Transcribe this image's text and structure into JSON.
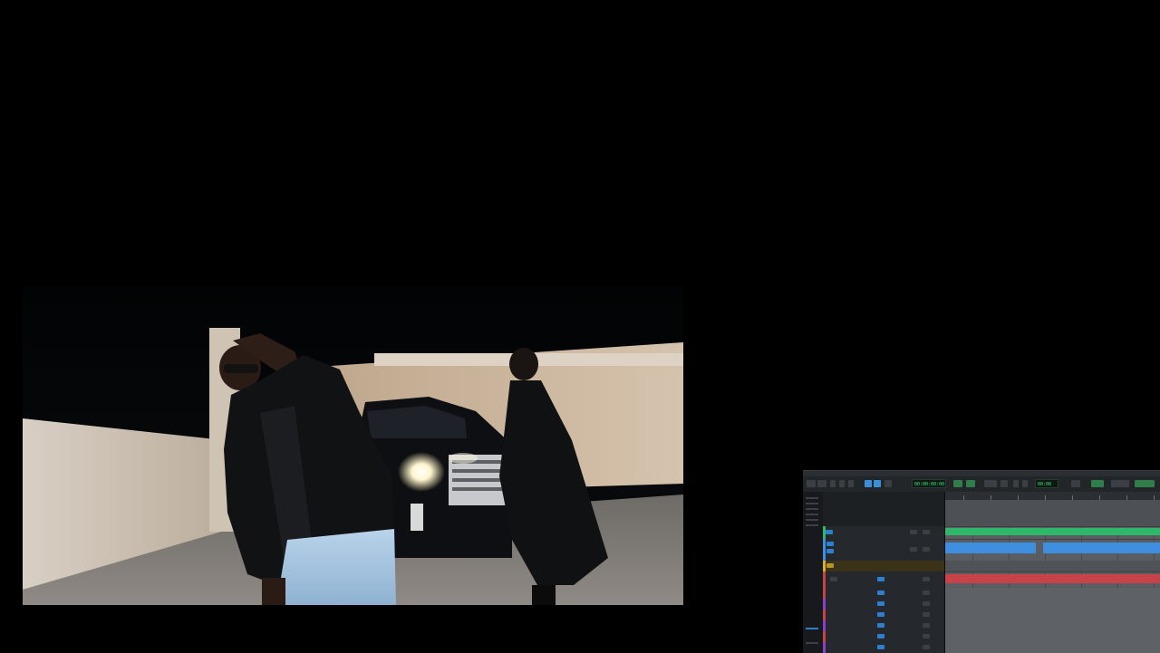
{
  "video": {
    "scene": "night-parking-garage"
  },
  "daw": {
    "counter_main": "00:00:00:00",
    "counter_sub": "00:00",
    "colors": {
      "green_track": "#2fb86a",
      "blue_track": "#3f8fe0",
      "red_track": "#c8424a",
      "accent_blue": "#3a8fd6",
      "timeline_bg": "#5a5d61"
    },
    "icons": [
      "play-icon",
      "stop-icon",
      "record-icon",
      "loop-icon"
    ]
  }
}
